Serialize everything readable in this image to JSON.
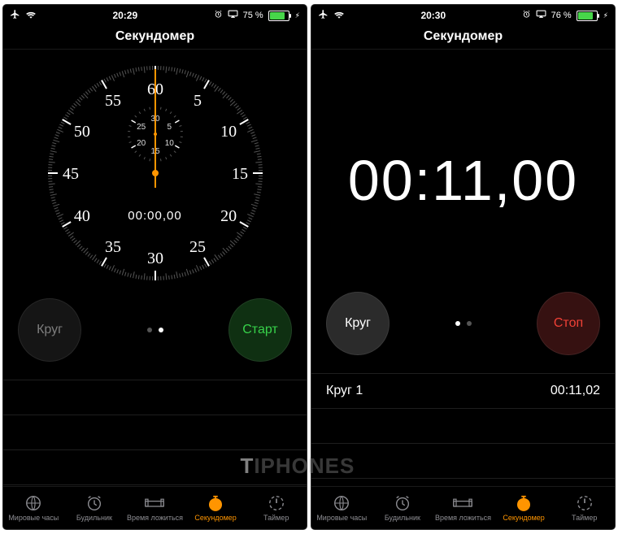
{
  "left": {
    "status": {
      "time": "20:29",
      "battery_pct": "75 %"
    },
    "header": {
      "title": "Секундомер"
    },
    "stopwatch": {
      "face_numbers": [
        "60",
        "5",
        "10",
        "15",
        "20",
        "25",
        "30",
        "35",
        "40",
        "45",
        "50",
        "55"
      ],
      "subdial_numbers": [
        "30",
        "5",
        "10",
        "15",
        "20",
        "25"
      ],
      "digital_mini": "00:00,00",
      "seconds_hand_angle_deg": 0
    },
    "buttons": {
      "lap_label": "Круг",
      "start_label": "Старт",
      "active_page": 1
    },
    "laps": [],
    "tabs": {
      "items": [
        {
          "label": "Мировые часы",
          "icon": "world-clock-icon"
        },
        {
          "label": "Будильник",
          "icon": "alarm-icon"
        },
        {
          "label": "Время ложиться",
          "icon": "bedtime-icon"
        },
        {
          "label": "Секундомер",
          "icon": "stopwatch-icon"
        },
        {
          "label": "Таймер",
          "icon": "timer-icon"
        }
      ],
      "active_index": 3
    }
  },
  "right": {
    "status": {
      "time": "20:30",
      "battery_pct": "76 %"
    },
    "header": {
      "title": "Секундомер"
    },
    "stopwatch": {
      "digital_big": "00:11,00"
    },
    "buttons": {
      "lap_label": "Круг",
      "stop_label": "Стоп",
      "active_page": 0
    },
    "laps": [
      {
        "name": "Круг 1",
        "time": "00:11,02"
      }
    ],
    "tabs": {
      "items": [
        {
          "label": "Мировые часы",
          "icon": "world-clock-icon"
        },
        {
          "label": "Будильник",
          "icon": "alarm-icon"
        },
        {
          "label": "Время ложиться",
          "icon": "bedtime-icon"
        },
        {
          "label": "Секундомер",
          "icon": "stopwatch-icon"
        },
        {
          "label": "Таймер",
          "icon": "timer-icon"
        }
      ],
      "active_index": 3
    }
  },
  "colors": {
    "accent_orange": "#ff9500",
    "start_green": "#37d24a",
    "stop_red": "#f04136"
  },
  "watermark": "IPHONES"
}
